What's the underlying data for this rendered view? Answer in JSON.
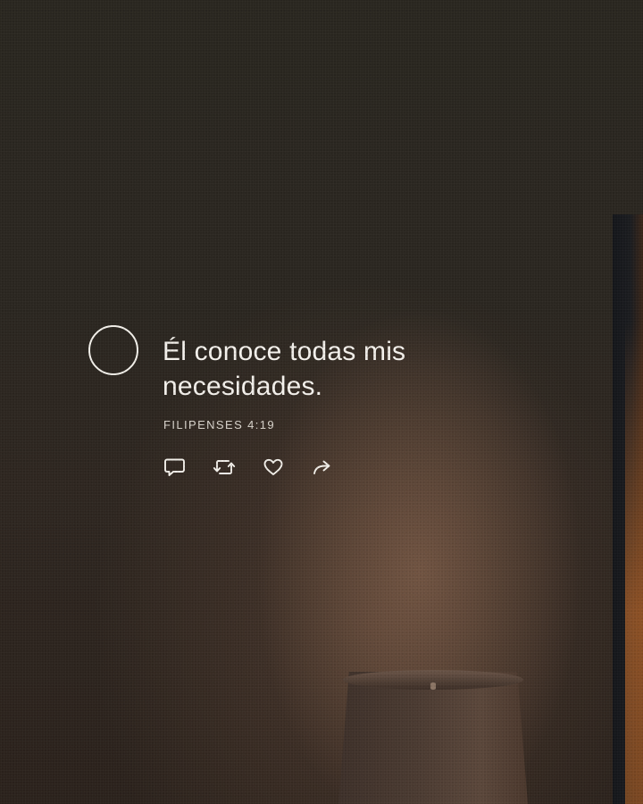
{
  "post": {
    "quote": "Él conoce todas mis necesidades.",
    "reference": "FILIPENSES 4:19"
  },
  "actions": [
    {
      "icon": "comment-icon"
    },
    {
      "icon": "repost-icon"
    },
    {
      "icon": "heart-icon"
    },
    {
      "icon": "share-icon"
    }
  ],
  "colors": {
    "text": "#f4f1ec",
    "reference": "#d9d4cc",
    "background": "#2a2520"
  }
}
